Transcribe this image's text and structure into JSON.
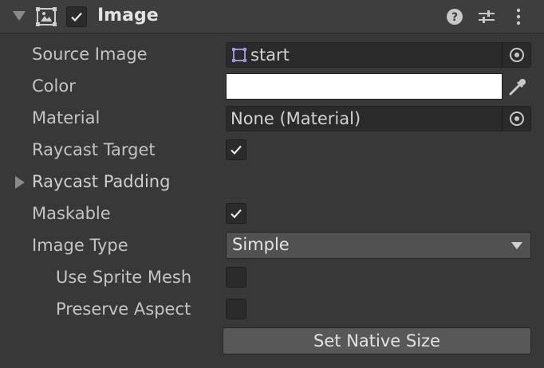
{
  "component": {
    "title": "Image",
    "enabled": true
  },
  "properties": {
    "source_image": {
      "label": "Source Image",
      "value": "start"
    },
    "color": {
      "label": "Color",
      "value": "#ffffff"
    },
    "material": {
      "label": "Material",
      "value": "None (Material)"
    },
    "raycast_target": {
      "label": "Raycast Target",
      "checked": true
    },
    "raycast_padding": {
      "label": "Raycast Padding",
      "expanded": false
    },
    "maskable": {
      "label": "Maskable",
      "checked": true
    },
    "image_type": {
      "label": "Image Type",
      "value": "Simple"
    },
    "use_sprite_mesh": {
      "label": "Use Sprite Mesh",
      "checked": false
    },
    "preserve_aspect": {
      "label": "Preserve Aspect",
      "checked": false
    }
  },
  "actions": {
    "set_native_size": "Set Native Size"
  },
  "icons": {
    "foldout": "foldout-arrow-icon",
    "component": "image-component-icon",
    "help": "help-icon",
    "presets": "presets-sliders-icon",
    "menu": "kebab-menu-icon",
    "sprite": "sprite-icon",
    "object_picker": "object-picker-icon",
    "eyedropper": "eyedropper-icon",
    "dropdown": "dropdown-arrow-icon"
  }
}
